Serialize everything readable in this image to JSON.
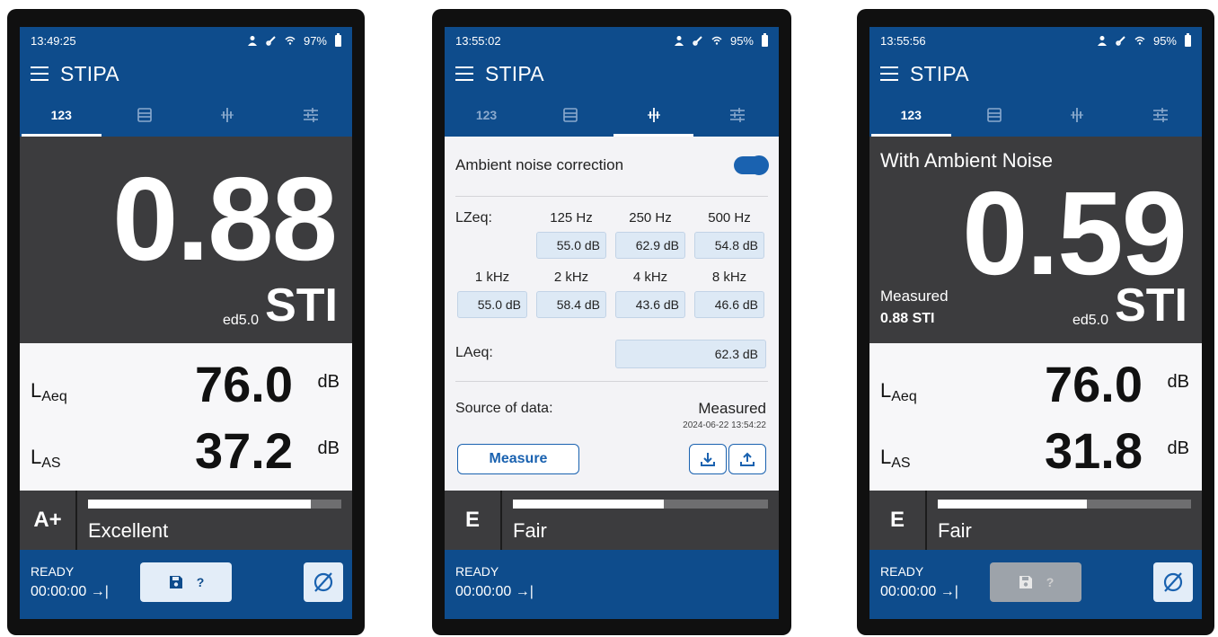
{
  "colors": {
    "brand_blue": "#0e4c8c",
    "dark_panel": "#3c3c3e",
    "accent": "#1a62b0",
    "field_bg": "#dde9f5"
  },
  "screens": [
    {
      "status": {
        "time": "13:49:25",
        "battery": "97%"
      },
      "app_title": "STIPA",
      "tabs": [
        {
          "label": "123",
          "icon": "numeric-tab",
          "active": true
        },
        {
          "label": "",
          "icon": "list-icon",
          "active": false
        },
        {
          "label": "",
          "icon": "spectrum-icon",
          "active": false
        },
        {
          "label": "",
          "icon": "sliders-icon",
          "active": false
        }
      ],
      "sti": {
        "value": "0.88",
        "edition": "ed5.0",
        "unit": "STI"
      },
      "levels": [
        {
          "name": "L",
          "sub": "Aeq",
          "value": "76.0",
          "unit": "dB"
        },
        {
          "name": "L",
          "sub": "AS",
          "value": "37.2",
          "unit": "dB"
        }
      ],
      "rating": {
        "grade": "A+",
        "label": "Excellent",
        "fraction": 0.88
      },
      "footer": {
        "state": "READY",
        "timer": "00:00:00 →|",
        "save_hint": "?",
        "null_icon": "empty-set-icon"
      }
    },
    {
      "status": {
        "time": "13:55:02",
        "battery": "95%"
      },
      "app_title": "STIPA",
      "tabs": [
        {
          "label": "123",
          "icon": "numeric-tab",
          "active": false
        },
        {
          "label": "",
          "icon": "list-icon",
          "active": false
        },
        {
          "label": "",
          "icon": "spectrum-icon",
          "active": true
        },
        {
          "label": "",
          "icon": "sliders-icon",
          "active": false
        }
      ],
      "settings": {
        "ambient_label": "Ambient noise correction",
        "ambient_on": true,
        "lzeq_label": "LZeq:",
        "bands": [
          {
            "freq": "125 Hz",
            "value": "55.0 dB"
          },
          {
            "freq": "250 Hz",
            "value": "62.9 dB"
          },
          {
            "freq": "500 Hz",
            "value": "54.8 dB"
          },
          {
            "freq": "1 kHz",
            "value": "55.0 dB"
          },
          {
            "freq": "2 kHz",
            "value": "58.4 dB"
          },
          {
            "freq": "4 kHz",
            "value": "43.6 dB"
          },
          {
            "freq": "8 kHz",
            "value": "46.6 dB"
          }
        ],
        "laeq_label": "LAeq:",
        "laeq_value": "62.3 dB",
        "source_label": "Source of data:",
        "source_value": "Measured",
        "source_time": "2024-06-22 13:54:22",
        "measure_label": "Measure"
      },
      "rating": {
        "grade": "E",
        "label": "Fair",
        "fraction": 0.59
      },
      "footer": {
        "state": "READY",
        "timer": "00:00:00 →|"
      }
    },
    {
      "status": {
        "time": "13:55:56",
        "battery": "95%"
      },
      "app_title": "STIPA",
      "tabs": [
        {
          "label": "123",
          "icon": "numeric-tab",
          "active": true
        },
        {
          "label": "",
          "icon": "list-icon",
          "active": false
        },
        {
          "label": "",
          "icon": "spectrum-icon",
          "active": false
        },
        {
          "label": "",
          "icon": "sliders-icon",
          "active": false
        }
      ],
      "sti": {
        "ambient_label": "With Ambient Noise",
        "value": "0.59",
        "edition": "ed5.0",
        "unit": "STI",
        "measured_label": "Measured",
        "measured_value": "0.88 STI"
      },
      "levels": [
        {
          "name": "L",
          "sub": "Aeq",
          "value": "76.0",
          "unit": "dB"
        },
        {
          "name": "L",
          "sub": "AS",
          "value": "31.8",
          "unit": "dB"
        }
      ],
      "rating": {
        "grade": "E",
        "label": "Fair",
        "fraction": 0.59
      },
      "footer": {
        "state": "READY",
        "timer": "00:00:00 →|",
        "save_hint": "?",
        "null_icon": "empty-set-icon"
      }
    }
  ]
}
